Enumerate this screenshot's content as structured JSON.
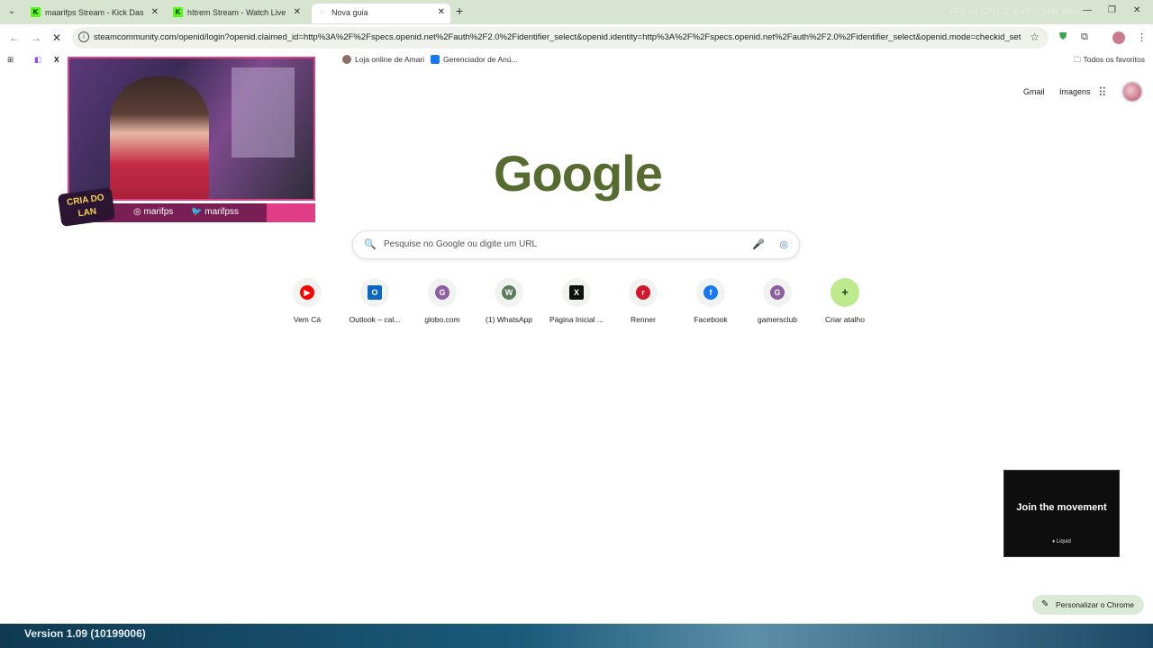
{
  "browser": {
    "tabs": [
      {
        "title": "maarifps Stream - Kick Dashboard",
        "favicon": "kick-icon",
        "active": false
      },
      {
        "title": "hItrem Stream - Watch Live on Kick",
        "favicon": "kick-icon",
        "active": false
      },
      {
        "title": "Nova guia",
        "favicon": "loading-icon",
        "active": true
      }
    ],
    "stats": "FPS 60   GPU 42%   CPU 14%   RAM 0",
    "url": "steamcommunity.com/openid/login?openid.claimed_id=http%3A%2F%2Fspecs.openid.net%2Fauth%2F2.0%2Fidentifier_select&openid.identity=http%3A%2F%2Fspecs.openid.net%2Fauth%2F2.0%2Fidentifier_select&openid.mode=checkid_setup&o..."
  },
  "bookmarks": {
    "items": [
      {
        "label": "Loja online de Amari",
        "color": "#8d6e63"
      },
      {
        "label": "Gerenciador de Anú...",
        "color": "#1877f2"
      }
    ],
    "all_label": "Todos os favoritos"
  },
  "newtab": {
    "links": {
      "gmail": "Gmail",
      "images": "Imagens"
    },
    "logo": "Google",
    "search_placeholder": "Pesquise no Google ou digite um URL",
    "shortcuts": [
      {
        "label": "Vem Cá",
        "glyph": "▶",
        "color": "#ff0000"
      },
      {
        "label": "Outlook – cal...",
        "glyph": "O",
        "color": "#0a66c2"
      },
      {
        "label": "globo.com",
        "glyph": "G",
        "color": "#8e5ea2"
      },
      {
        "label": "(1) WhatsApp",
        "glyph": "W",
        "color": "#5b7b5b"
      },
      {
        "label": "Página Inicial ...",
        "glyph": "X",
        "color": "#111111"
      },
      {
        "label": "Renner",
        "glyph": "r",
        "color": "#d3182c"
      },
      {
        "label": "Facebook",
        "glyph": "f",
        "color": "#1877f2"
      },
      {
        "label": "gamersclub",
        "glyph": "G",
        "color": "#8e5ea2"
      },
      {
        "label": "Criar atalho",
        "glyph": "+",
        "color": "#bde98f"
      }
    ],
    "customize_label": "Personalizar o Chrome"
  },
  "ad": {
    "headline": "Join the movement",
    "brand": "♦ Liquid"
  },
  "overlay": {
    "instagram": "marifps",
    "twitter": "marifpss",
    "badge": "CRIA DO LAN"
  },
  "game": {
    "version": "Version 1.09 (10199006)"
  }
}
